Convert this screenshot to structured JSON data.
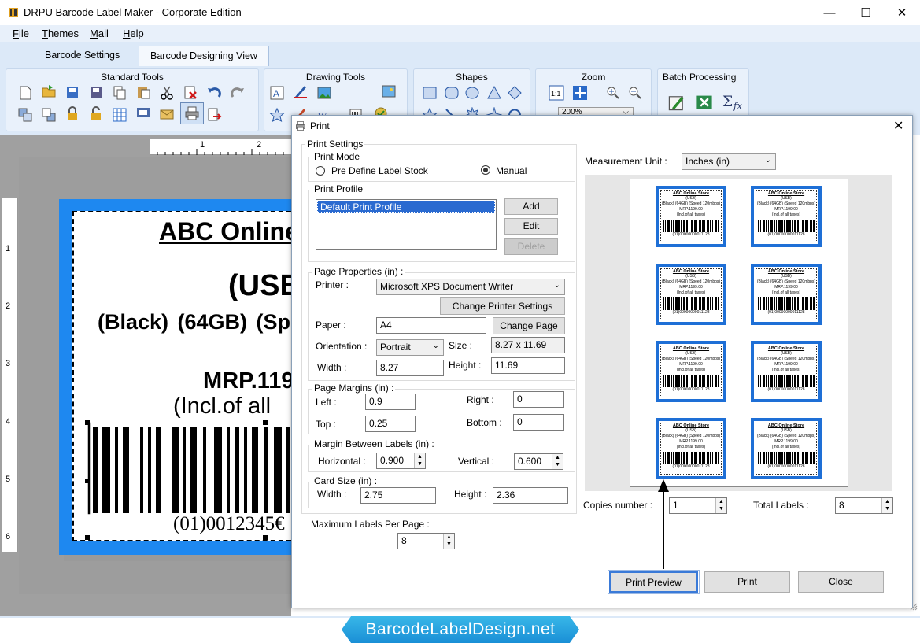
{
  "window": {
    "title": "DRPU Barcode Label Maker - Corporate Edition"
  },
  "menu": [
    {
      "label": "File",
      "u": "F",
      "rest": "ile"
    },
    {
      "label": "Themes",
      "u": "T",
      "rest": "hemes"
    },
    {
      "label": "Mail",
      "u": "M",
      "rest": "ail"
    },
    {
      "label": "Help",
      "u": "H",
      "rest": "elp"
    }
  ],
  "tabs": {
    "settings": "Barcode Settings",
    "designing": "Barcode Designing View"
  },
  "ribbon": {
    "standard_tools": "Standard Tools",
    "drawing_tools": "Drawing Tools",
    "shapes": "Shapes",
    "zoom": "Zoom",
    "zoom_value": "200%",
    "batch_processing": "Batch Processing"
  },
  "rulers": {
    "h": [
      "1",
      "2"
    ],
    "v": [
      "1",
      "2",
      "3",
      "4",
      "5",
      "6"
    ]
  },
  "label": {
    "store": "ABC Online",
    "usb": "(USB",
    "specs": "(Black) (64GB) (Sp",
    "mrp": "MRP.119",
    "incl": "(Incl.of all",
    "barcode_text": "(01)0012345€"
  },
  "dialog": {
    "title": "Print",
    "print_settings": "Print Settings",
    "print_mode": "Print Mode",
    "mode_predefine": "Pre Define Label Stock",
    "mode_manual": "Manual",
    "print_profile": "Print Profile",
    "profile_selected": "Default Print Profile",
    "add": "Add",
    "edit": "Edit",
    "delete": "Delete",
    "page_properties": "Page Properties (in) :",
    "printer_label": "Printer :",
    "printer_value": "Microsoft XPS Document Writer",
    "change_printer": "Change Printer Settings",
    "paper_label": "Paper :",
    "paper_value": "A4",
    "change_page": "Change Page",
    "orientation_label": "Orientation :",
    "orientation_value": "Portrait",
    "size_label": "Size :",
    "size_value": "8.27 x 11.69",
    "width_label": "Width :",
    "width_value": "8.27",
    "height_label": "Height :",
    "height_value": "11.69",
    "page_margins": "Page Margins (in) :",
    "left_label": "Left :",
    "left_value": "0.9",
    "right_label": "Right :",
    "right_value": "0",
    "top_label": "Top :",
    "top_value": "0.25",
    "bottom_label": "Bottom :",
    "bottom_value": "0",
    "margin_between": "Margin Between Labels (in) :",
    "horizontal_label": "Horizontal :",
    "horizontal_value": "0.900",
    "vertical_label": "Vertical :",
    "vertical_value": "0.600",
    "card_size": "Card Size (in) :",
    "card_width_label": "Width :",
    "card_width_value": "2.75",
    "card_height_label": "Height :",
    "card_height_value": "2.36",
    "max_labels_label": "Maximum Labels Per Page :",
    "max_labels_value": "8",
    "measurement_label": "Measurement Unit :",
    "measurement_value": "Inches (in)",
    "copies_label": "Copies number :",
    "copies_value": "1",
    "total_label": "Total Labels :",
    "total_value": "8",
    "print_preview": "Print Preview",
    "print": "Print",
    "close": "Close"
  },
  "mini_label": {
    "title": "ABC Online Store",
    "usb": "(USB)",
    "specs": "(Black) (64GB) (Speed 120mbps)",
    "mrp": "MRP.1199.00",
    "incl": "(Incl.of all taxes)",
    "code": "(01)00000000011128"
  },
  "brand": "BarcodeLabelDesign.net",
  "colors": {
    "label_blue": "#1e88f0",
    "ribbon": "#dce9f8",
    "brand": "#1a8fd6"
  }
}
